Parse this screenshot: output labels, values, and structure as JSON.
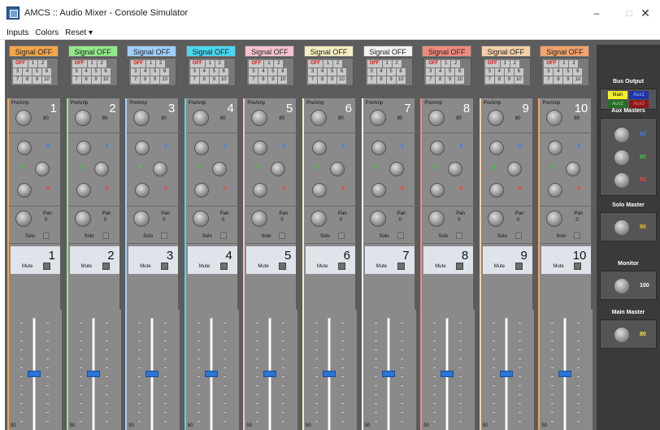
{
  "window": {
    "title": "AMCS :: Audio Mixer - Console Simulator",
    "minimize": "–",
    "maximize": "□",
    "close": "✕"
  },
  "menu": [
    "Inputs",
    "Colors",
    "Reset ▾"
  ],
  "channels": [
    {
      "signal": "Signal OFF",
      "color": "#f3a64a",
      "number": "1",
      "preamp": "PreAmp",
      "preamp_value": "80",
      "pan_label": "Pan",
      "pan_value": "0",
      "solo": "Solo",
      "mute": "Mute",
      "aux_values": [
        "0",
        "0",
        "0"
      ],
      "fader_value": "50"
    },
    {
      "signal": "Signal OFF",
      "color": "#93e98a",
      "number": "2",
      "preamp": "PreAmp",
      "preamp_value": "80",
      "pan_label": "Pan",
      "pan_value": "0",
      "solo": "Solo",
      "mute": "Mute",
      "aux_values": [
        "0",
        "0",
        "0"
      ],
      "fader_value": "50"
    },
    {
      "signal": "Signal OFF",
      "color": "#9fcfff",
      "number": "3",
      "preamp": "PreAmp",
      "preamp_value": "80",
      "pan_label": "Pan",
      "pan_value": "0",
      "solo": "Solo",
      "mute": "Mute",
      "aux_values": [
        "0",
        "0",
        "0"
      ],
      "fader_value": "50"
    },
    {
      "signal": "Signal OFF",
      "color": "#4ad8f0",
      "number": "4",
      "preamp": "PreAmp",
      "preamp_value": "80",
      "pan_label": "Pan",
      "pan_value": "0",
      "solo": "Solo",
      "mute": "Mute",
      "aux_values": [
        "0",
        "0",
        "0"
      ],
      "fader_value": "50"
    },
    {
      "signal": "Signal OFF",
      "color": "#f7c2cf",
      "number": "5",
      "preamp": "PreAmp",
      "preamp_value": "80",
      "pan_label": "Pan",
      "pan_value": "0",
      "solo": "Solo",
      "mute": "Mute",
      "aux_values": [
        "0",
        "0",
        "0"
      ],
      "fader_value": "50"
    },
    {
      "signal": "Signal OFF",
      "color": "#f4efc2",
      "number": "6",
      "preamp": "PreAmp",
      "preamp_value": "80",
      "pan_label": "Pan",
      "pan_value": "0",
      "solo": "Solo",
      "mute": "Mute",
      "aux_values": [
        "0",
        "0",
        "0"
      ],
      "fader_value": "50"
    },
    {
      "signal": "Signal OFF",
      "color": "#f2f2f2",
      "number": "7",
      "preamp": "PreAmp",
      "preamp_value": "80",
      "pan_label": "Pan",
      "pan_value": "0",
      "solo": "Solo",
      "mute": "Mute",
      "aux_values": [
        "0",
        "0",
        "0"
      ],
      "fader_value": "50"
    },
    {
      "signal": "Signal OFF",
      "color": "#f08a7e",
      "number": "8",
      "preamp": "PreAmp",
      "preamp_value": "80",
      "pan_label": "Pan",
      "pan_value": "0",
      "solo": "Solo",
      "mute": "Mute",
      "aux_values": [
        "0",
        "0",
        "0"
      ],
      "fader_value": "50"
    },
    {
      "signal": "Signal OFF",
      "color": "#f3d0a8",
      "number": "9",
      "preamp": "PreAmp",
      "preamp_value": "80",
      "pan_label": "Pan",
      "pan_value": "0",
      "solo": "Solo",
      "mute": "Mute",
      "aux_values": [
        "0",
        "0",
        "0"
      ],
      "fader_value": "50"
    },
    {
      "signal": "Signal OFF",
      "color": "#f2a36e",
      "number": "10",
      "preamp": "PreAmp",
      "preamp_value": "80",
      "pan_label": "Pan",
      "pan_value": "0",
      "solo": "Solo",
      "mute": "Mute",
      "aux_values": [
        "0",
        "0",
        "0"
      ],
      "fader_value": "50"
    }
  ],
  "selector": {
    "rows": [
      [
        "OFF",
        "1",
        "2"
      ],
      [
        "3",
        "4",
        "5",
        "6"
      ],
      [
        "7",
        "8",
        "9",
        "10"
      ]
    ]
  },
  "right_panel": {
    "bus_output": {
      "label": "Bus Output",
      "buttons": [
        {
          "label": "Main",
          "color": "#f5ef2b",
          "text_color": "#111111"
        },
        {
          "label": "Aux1",
          "color": "#2233aa",
          "text_color": "#8fd0ff"
        },
        {
          "label": "Aux2",
          "color": "#2a6b2a",
          "text_color": "#8fe88f"
        },
        {
          "label": "Aux3",
          "color": "#8a1b1b",
          "text_color": "#ff6b6b"
        }
      ]
    },
    "aux_masters": {
      "label": "Aux Masters",
      "values": [
        "80",
        "80",
        "80"
      ],
      "colors": [
        "#3a7bff",
        "#3ad23a",
        "#ff3a3a"
      ]
    },
    "solo_master": {
      "label": "Solo Master",
      "value": "80",
      "color": "#f0c020"
    },
    "monitor": {
      "label": "Monitor",
      "value": "100",
      "color": "#ffffff"
    },
    "main_master": {
      "label": "Main Master",
      "value": "80",
      "color": "#f5ef2b"
    }
  },
  "aux_colors": [
    "#3a7bff",
    "#3ad23a",
    "#ff3a3a"
  ]
}
